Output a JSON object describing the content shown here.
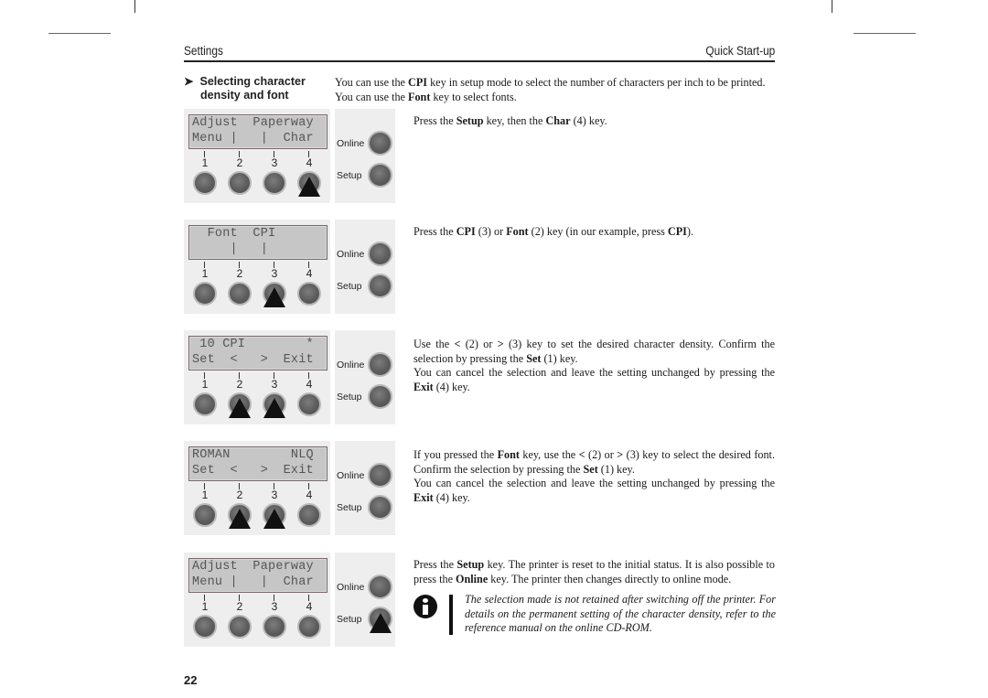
{
  "header": {
    "left": "Settings",
    "right": "Quick Start-up"
  },
  "section": {
    "title_line1": "Selecting character",
    "title_line2": "density and font",
    "arrow_icon": "➤",
    "intro_line1": [
      "You can use the ",
      "CPI",
      " key in setup mode to select the number of characters per inch to be printed."
    ],
    "intro_line2": [
      "You can use the ",
      "Font",
      " key to select fonts."
    ]
  },
  "side_keys": {
    "online": "Online",
    "setup": "Setup"
  },
  "key_numbers": [
    "1",
    "2",
    "3",
    "4"
  ],
  "steps": [
    {
      "lcd_row1": "Adjust  Paperway",
      "lcd_row2": "Menu |   |  Char",
      "pressed": [
        "4"
      ],
      "text": [
        "Press the ",
        "Setup",
        " key, then the ",
        "Char",
        " (4) key."
      ]
    },
    {
      "lcd_row1": "  Font  CPI",
      "lcd_row2": "     |   |",
      "pressed": [
        "3"
      ],
      "text": [
        "Press the ",
        "CPI",
        " (3) or ",
        "Font",
        " (2) key (in our example, press ",
        "CPI",
        ")."
      ]
    },
    {
      "lcd_row1": " 10 CPI        *",
      "lcd_row2": "Set  <   >  Exit",
      "pressed": [
        "2",
        "3"
      ],
      "text_a": [
        "Use the ",
        "<",
        " (2) or ",
        ">",
        " (3) key to set the desired character density. Confirm the selection by pressing the ",
        "Set",
        " (1) key."
      ],
      "text_b": [
        "You can cancel the selection and leave the setting unchanged by pressing the ",
        "Exit",
        " (4) key."
      ]
    },
    {
      "lcd_row1": "ROMAN        NLQ",
      "lcd_row2": "Set  <   >  Exit",
      "pressed": [
        "2",
        "3"
      ],
      "text_a": [
        "If you pressed the ",
        "Font",
        " key, use the ",
        "<",
        " (2) or ",
        ">",
        " (3) key to select the desired font. Confirm the selection by pressing the ",
        "Set",
        " (1) key."
      ],
      "text_b": [
        "You can cancel the selection and leave the setting unchanged by pressing the ",
        "Exit",
        " (4) key."
      ]
    },
    {
      "lcd_row1": "Adjust  Paperway",
      "lcd_row2": "Menu |   |  Char",
      "pressed": [
        "Setup"
      ],
      "text": [
        "Press the ",
        "Setup",
        " key. The printer is reset to the initial status. It is also possible to press the ",
        "Online",
        " key. The printer then changes directly to online mode."
      ]
    }
  ],
  "note": "The selection made is not retained after switching off the printer. For details on the permanent setting of the character density, refer to the reference manual on the online CD-ROM.",
  "page_number": "22"
}
